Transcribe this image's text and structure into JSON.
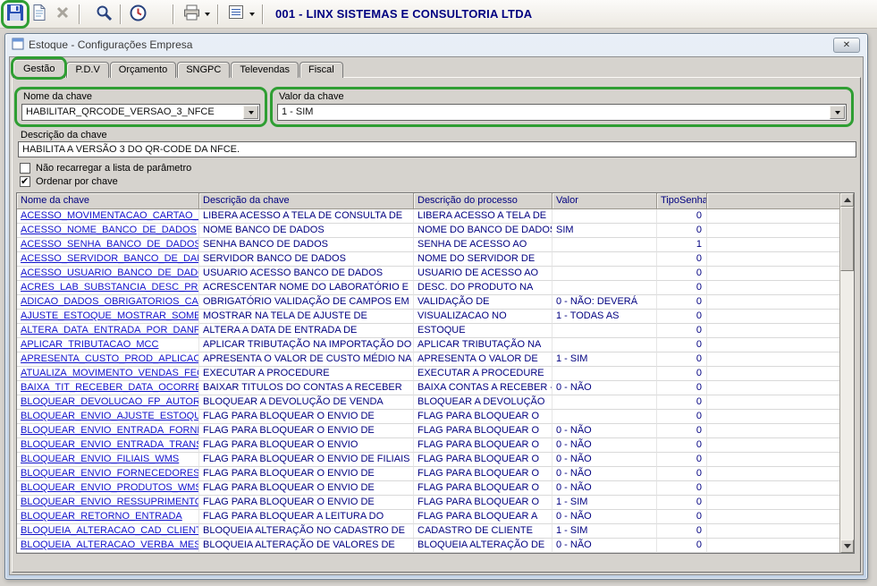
{
  "toolbar": {
    "company_label": "001 - LINX SISTEMAS E CONSULTORIA LTDA"
  },
  "window": {
    "title": "Estoque - Configurações Empresa",
    "close_glyph": "✕"
  },
  "tabs": [
    {
      "label": "Gestão",
      "selected": true,
      "annotated": true
    },
    {
      "label": "P.D.V",
      "selected": false
    },
    {
      "label": "Orçamento",
      "selected": false
    },
    {
      "label": "SNGPC",
      "selected": false
    },
    {
      "label": "Televendas",
      "selected": false
    },
    {
      "label": "Fiscal",
      "selected": false
    }
  ],
  "fields": {
    "key_name": {
      "label": "Nome da chave",
      "value": "HABILITAR_QRCODE_VERSAO_3_NFCE"
    },
    "key_value": {
      "label": "Valor da chave",
      "value": "1 - SIM"
    },
    "key_description": {
      "label": "Descrição da chave",
      "value": "HABILITA A VERSÃO 3 DO QR-CODE DA NFCE."
    }
  },
  "options": [
    {
      "label": "Não recarregar a lista de parâmetro",
      "checked": false
    },
    {
      "label": "Ordenar por chave",
      "checked": true
    }
  ],
  "grid": {
    "columns": [
      "Nome da chave",
      "Descrição  da chave",
      "Descrição do processo",
      "Valor",
      "TipoSenha"
    ],
    "rows": [
      [
        "ACESSO_MOVIMENTACAO_CARTAO_M",
        "LIBERA ACESSO A TELA DE CONSULTA DE",
        "LIBERA ACESSO A TELA DE",
        "",
        "0"
      ],
      [
        "ACESSO_NOME_BANCO_DE_DADOS",
        "NOME BANCO DE DADOS",
        "NOME DO BANCO DE DADOS",
        "SIM",
        "0"
      ],
      [
        "ACESSO_SENHA_BANCO_DE_DADOS",
        "SENHA BANCO DE DADOS",
        "SENHA DE ACESSO AO",
        "",
        "1"
      ],
      [
        "ACESSO_SERVIDOR_BANCO_DE_DAD",
        "SERVIDOR BANCO DE DADOS",
        "NOME DO SERVIDOR DE",
        "",
        "0"
      ],
      [
        "ACESSO_USUARIO_BANCO_DE_DADC",
        "USUARIO ACESSO BANCO DE DADOS",
        "USUARIO DE ACESSO AO",
        "",
        "0"
      ],
      [
        "ACRES_LAB_SUBSTANCIA_DESC_PRO",
        "ACRESCENTAR NOME DO LABORATÓRIO E",
        "DESC. DO PRODUTO NA",
        "",
        "0"
      ],
      [
        "ADICAO_DADOS_OBRIGATORIOS_CAD",
        "OBRIGATÓRIO VALIDAÇÃO DE CAMPOS EM",
        "VALIDAÇÃO DE",
        "0 - NÃO: DEVERÁ",
        "0"
      ],
      [
        "AJUSTE_ESTOQUE_MOSTRAR_SOME",
        "MOSTRAR NA TELA DE AJUSTE DE",
        "VISUALIZACAO NO",
        "1 - TODAS AS",
        "0"
      ],
      [
        "ALTERA_DATA_ENTRADA_POR_DANF",
        "ALTERA A DATA DE ENTRADA DE",
        "ESTOQUE",
        "",
        "0"
      ],
      [
        "APLICAR_TRIBUTACAO_MCC",
        "APLICAR TRIBUTAÇÃO NA IMPORTAÇÃO DO",
        "APLICAR TRIBUTAÇÃO NA",
        "",
        "0"
      ],
      [
        "APRESENTA_CUSTO_PROD_APLICAC",
        "APRESENTA O VALOR DE CUSTO MÉDIO NA",
        "APRESENTA O VALOR DE",
        "1 - SIM",
        "0"
      ],
      [
        "ATUALIZA_MOVIMENTO_VENDAS_FEC",
        "EXECUTAR A PROCEDURE",
        "EXECUTAR A PROCEDURE",
        "",
        "0"
      ],
      [
        "BAIXA_TIT_RECEBER_DATA_OCORRE",
        "BAIXAR TITULOS DO CONTAS A RECEBER",
        "BAIXA CONTAS A RECEBER -",
        "0 - NÃO",
        "0"
      ],
      [
        "BLOQUEAR_DEVOLUCAO_FP_AUTORI",
        "BLOQUEAR A DEVOLUÇÃO DE VENDA",
        "BLOQUEAR A DEVOLUÇÃO",
        "",
        "0"
      ],
      [
        "BLOQUEAR_ENVIO_AJUSTE_ESTOQU",
        "FLAG PARA BLOQUEAR O ENVIO DE",
        "FLAG PARA BLOQUEAR O",
        "",
        "0"
      ],
      [
        "BLOQUEAR_ENVIO_ENTRADA_FORNE",
        "FLAG PARA BLOQUEAR O ENVIO DE",
        "FLAG PARA BLOQUEAR O",
        "0 - NÃO",
        "0"
      ],
      [
        "BLOQUEAR_ENVIO_ENTRADA_TRANS",
        "FLAG PARA BLOQUEAR O ENVIO",
        "FLAG PARA BLOQUEAR O",
        "0 - NÃO",
        "0"
      ],
      [
        "BLOQUEAR_ENVIO_FILIAIS_WMS",
        "FLAG PARA BLOQUEAR O ENVIO DE FILIAIS",
        "FLAG PARA BLOQUEAR O",
        "0 - NÃO",
        "0"
      ],
      [
        "BLOQUEAR_ENVIO_FORNECEDORES_",
        "FLAG PARA BLOQUEAR O ENVIO DE",
        "FLAG PARA BLOQUEAR O",
        "0 - NÃO",
        "0"
      ],
      [
        "BLOQUEAR_ENVIO_PRODUTOS_WMS",
        "FLAG PARA BLOQUEAR O ENVIO DE",
        "FLAG PARA BLOQUEAR O",
        "0 - NÃO",
        "0"
      ],
      [
        "BLOQUEAR_ENVIO_RESSUPRIMENTO",
        "FLAG PARA BLOQUEAR O ENVIO DE",
        "FLAG PARA BLOQUEAR O",
        "1 - SIM",
        "0"
      ],
      [
        "BLOQUEAR_RETORNO_ENTRADA",
        "FLAG PARA BLOQUEAR A LEITURA DO",
        "FLAG PARA BLOQUEAR A",
        "0 - NÃO",
        "0"
      ],
      [
        "BLOQUEIA_ALTERACAO_CAD_CLIENT",
        "BLOQUEIA ALTERAÇÃO NO CADASTRO DE",
        "CADASTRO DE CLIENTE",
        "1 - SIM",
        "0"
      ],
      [
        "BLOQUEIA_ALTERACAO_VERBA_MES",
        "BLOQUEIA ALTERAÇÃO DE VALORES DE",
        "BLOQUEIA ALTERAÇÃO DE",
        "0 - NÃO",
        "0"
      ]
    ]
  },
  "colors": {
    "annotation": "#2f9e33",
    "grid_link": "#1212cc",
    "grid_text": "#000080",
    "company": "#000080"
  }
}
